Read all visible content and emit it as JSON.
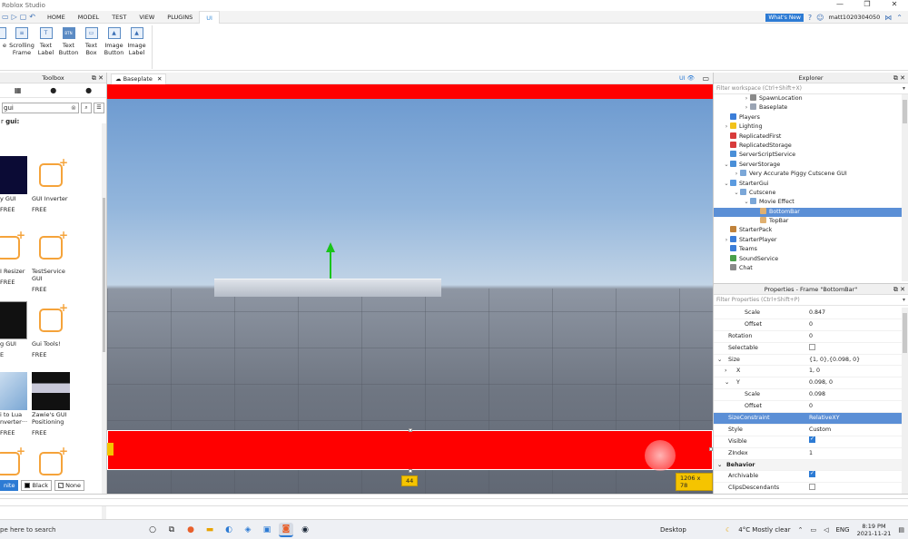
{
  "window": {
    "title": "Roblox Studio",
    "controls": [
      "—",
      "❐",
      "✕"
    ]
  },
  "ribbon_tabs": [
    "HOME",
    "MODEL",
    "TEST",
    "VIEW",
    "PLUGINS",
    "UI"
  ],
  "active_tab": "UI",
  "account": {
    "whats_new": "What's New",
    "username": "matt1020304050"
  },
  "ribbon_items": [
    {
      "label": "e",
      "icon": "frame-icon"
    },
    {
      "label": "Scrolling Frame",
      "icon": "scrolling-frame-icon"
    },
    {
      "label": "Text Label",
      "icon": "text-label-icon"
    },
    {
      "label": "Text Button",
      "icon": "text-button-icon"
    },
    {
      "label": "Text Box",
      "icon": "text-box-icon"
    },
    {
      "label": "Image Button",
      "icon": "image-button-icon"
    },
    {
      "label": "Image Label",
      "icon": "image-label-icon"
    }
  ],
  "toolbox": {
    "title": "Toolbox",
    "search_value": "gui",
    "results_prefix": "r",
    "results_query": "gui:",
    "items": [
      {
        "name": "y GUI",
        "price": "FREE",
        "thumb": "dark"
      },
      {
        "name": "GUI Inverter",
        "price": "FREE",
        "thumb": "puzzle"
      },
      {
        "name": "I Resizer",
        "price": "FREE",
        "thumb": "puzzle"
      },
      {
        "name": "TestService GUI",
        "price": "FREE",
        "thumb": "puzzle"
      },
      {
        "name": "g GUI",
        "price": "E",
        "thumb": "black"
      },
      {
        "name": "Gui Tools!",
        "price": "FREE",
        "thumb": "puzzle"
      },
      {
        "name": "i to Lua nverter···",
        "price": "FREE",
        "thumb": "lua"
      },
      {
        "name": "Zawie's GUI Positioning",
        "price": "FREE",
        "thumb": "zawie"
      },
      {
        "name": "",
        "price": "",
        "thumb": "puzzle"
      },
      {
        "name": "",
        "price": "",
        "thumb": "puzzle"
      }
    ],
    "bg_options": [
      "nite",
      "Black",
      "None"
    ]
  },
  "viewport": {
    "tab_label": "Baseplate",
    "ui_toggle": "UI",
    "offset_badge": "44",
    "size_badge": "1206 x 78"
  },
  "explorer": {
    "title": "Explorer",
    "filter_placeholder": "Filter workspace (Ctrl+Shift+X)",
    "rows": [
      {
        "label": "SpawnLocation",
        "depth": 2,
        "arrow": "›",
        "color": "#8a8a8a"
      },
      {
        "label": "Baseplate",
        "depth": 2,
        "arrow": "›",
        "color": "#9aa4b4"
      },
      {
        "label": "Players",
        "depth": 0,
        "arrow": "",
        "color": "#3b7dd8"
      },
      {
        "label": "Lighting",
        "depth": 0,
        "arrow": "›",
        "color": "#f2c21b"
      },
      {
        "label": "ReplicatedFirst",
        "depth": 0,
        "arrow": "",
        "color": "#d83b3b"
      },
      {
        "label": "ReplicatedStorage",
        "depth": 0,
        "arrow": "",
        "color": "#d83b3b"
      },
      {
        "label": "ServerScriptService",
        "depth": 0,
        "arrow": "",
        "color": "#4a8fd8"
      },
      {
        "label": "ServerStorage",
        "depth": 0,
        "arrow": "⌄",
        "color": "#4a8fd8"
      },
      {
        "label": "Very Accurate Piggy Cutscene GUI",
        "depth": 1,
        "arrow": "›",
        "color": "#7ba7d8"
      },
      {
        "label": "StarterGui",
        "depth": 0,
        "arrow": "⌄",
        "color": "#5b9be0"
      },
      {
        "label": "Cutscene",
        "depth": 1,
        "arrow": "⌄",
        "color": "#7ba7d8"
      },
      {
        "label": "Movie Effect",
        "depth": 2,
        "arrow": "⌄",
        "color": "#7ba7d8"
      },
      {
        "label": "BottomBar",
        "depth": 3,
        "arrow": "",
        "color": "#e0b070",
        "selected": true
      },
      {
        "label": "TopBar",
        "depth": 3,
        "arrow": "",
        "color": "#e0b070"
      },
      {
        "label": "StarterPack",
        "depth": 0,
        "arrow": "",
        "color": "#c0823b"
      },
      {
        "label": "StarterPlayer",
        "depth": 0,
        "arrow": "›",
        "color": "#3b7dd8"
      },
      {
        "label": "Teams",
        "depth": 0,
        "arrow": "",
        "color": "#3b7dd8"
      },
      {
        "label": "SoundService",
        "depth": 0,
        "arrow": "",
        "color": "#4aa04a"
      },
      {
        "label": "Chat",
        "depth": 0,
        "arrow": "",
        "color": "#8a8a8a"
      }
    ]
  },
  "properties": {
    "title": "Properties - Frame \"BottomBar\"",
    "filter_placeholder": "Filter Properties (Ctrl+Shift+P)",
    "rows": [
      {
        "name": "Scale",
        "value": "0.847",
        "indent": 2
      },
      {
        "name": "Offset",
        "value": "0",
        "indent": 2
      },
      {
        "name": "Rotation",
        "value": "0",
        "indent": 0
      },
      {
        "name": "Selectable",
        "value": "",
        "check": "off",
        "indent": 0
      },
      {
        "name": "Size",
        "value": "{1, 0},{0.098, 0}",
        "indent": 0,
        "arrow": "⌄"
      },
      {
        "name": "X",
        "value": "1, 0",
        "indent": 1,
        "arrow": "›"
      },
      {
        "name": "Y",
        "value": "0.098, 0",
        "indent": 1,
        "arrow": "⌄"
      },
      {
        "name": "Scale",
        "value": "0.098",
        "indent": 2
      },
      {
        "name": "Offset",
        "value": "0",
        "indent": 2
      },
      {
        "name": "SizeConstraint",
        "value": "RelativeXY",
        "indent": 0,
        "selected": true
      },
      {
        "name": "Style",
        "value": "Custom",
        "indent": 0
      },
      {
        "name": "Visible",
        "value": "",
        "check": "on",
        "indent": 0
      },
      {
        "name": "ZIndex",
        "value": "1",
        "indent": 0
      },
      {
        "name": "Behavior",
        "value": "",
        "category": true
      },
      {
        "name": "Archivable",
        "value": "",
        "check": "on",
        "indent": 0
      },
      {
        "name": "ClipsDescendants",
        "value": "",
        "check": "off",
        "indent": 0
      }
    ]
  },
  "taskbar": {
    "search": "pe here to search",
    "desktop": "Desktop",
    "weather": "4°C  Mostly clear",
    "lang": "ENG",
    "time": "8:19 PM",
    "date": "2021-11-21"
  },
  "colors": {
    "accent": "#2d7bd4",
    "gui_frame": "#ff0000",
    "selection": "#5b8fd6"
  }
}
